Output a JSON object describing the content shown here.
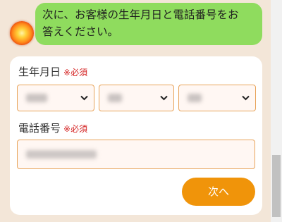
{
  "chat": {
    "bot_message_line1": "次に、お客様の生年月日と電話番号をお",
    "bot_message_line2": "答えください。"
  },
  "form": {
    "birthdate": {
      "label": "生年月日",
      "required_mark": "※必須",
      "year_icon": "chevron-down-icon",
      "month_icon": "chevron-down-icon",
      "day_icon": "chevron-down-icon"
    },
    "phone": {
      "label": "電話番号",
      "required_mark": "※必須"
    },
    "next_button_label": "次へ"
  },
  "colors": {
    "background": "#f3e6d8",
    "bubble": "#8fdc5e",
    "field_border": "#e8a45a",
    "field_bg": "#fff7f3",
    "required": "#d42020",
    "button": "#f0940a"
  }
}
